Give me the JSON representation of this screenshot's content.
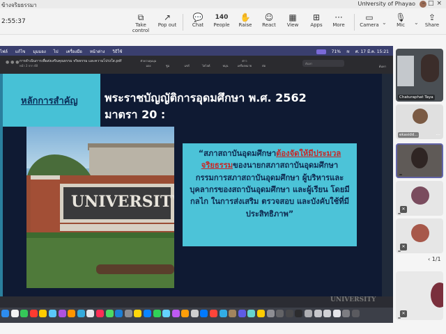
{
  "titlebar": {
    "left_text": "ข้างจริยธรรมา",
    "dots": "···",
    "org_name": "University of Phayao",
    "window_controls": "–□×"
  },
  "toolbar": {
    "timer": "2:55:37",
    "buttons": [
      {
        "icon": "take-control-icon",
        "glyph": "⧉",
        "label": "Take control"
      },
      {
        "icon": "pop-out-icon",
        "glyph": "↗",
        "label": "Pop out"
      },
      {
        "icon": "chat-icon",
        "glyph": "💬",
        "label": "Chat"
      },
      {
        "icon": "people-icon",
        "glyph": "140",
        "label": "People"
      },
      {
        "icon": "raise-hand-icon",
        "glyph": "✋",
        "label": "Raise"
      },
      {
        "icon": "react-icon",
        "glyph": "☺",
        "label": "React"
      },
      {
        "icon": "view-icon",
        "glyph": "▦",
        "label": "View"
      },
      {
        "icon": "apps-icon",
        "glyph": "⊞",
        "label": "Apps"
      },
      {
        "icon": "more-icon",
        "glyph": "···",
        "label": "More"
      },
      {
        "icon": "camera-icon",
        "glyph": "▭",
        "label": "Camera"
      },
      {
        "icon": "mic-off-icon",
        "glyph": "🎙",
        "label": "Mic"
      },
      {
        "icon": "share-icon",
        "glyph": "⇪",
        "label": "Share"
      }
    ]
  },
  "macbar": {
    "menu": [
      "ไฟล์",
      "แก้ไข",
      "มุมมอง",
      "ไป",
      "เครื่องมือ",
      "หน้าต่าง",
      "วิธีใช้"
    ],
    "status": [
      "71%",
      "ศ. 17 มี.ค. 15:21"
    ]
  },
  "viewer": {
    "filename": "การดำเนินการเพื่อส่งเสริมคุณธรรม จริยธรรม และความโปร่งใส.pdf",
    "pages": "หน้า 3 จาก 48",
    "tools": [
      "ตัวควบคุมมุมมอง",
      "ซูม",
      "แชร์",
      "ไฮไลต์",
      "หมุน",
      "ต่าวเครื่องหมาย",
      "ต่อ"
    ],
    "search_placeholder": "ค้นหา",
    "share_label": "ค้นหา"
  },
  "slide": {
    "keyword": "หลักการสำคัญ",
    "headline_line1": "พระราชบัญญัติการอุดมศึกษา พ.ศ. 2562",
    "headline_line2": "มาตรา 20 :",
    "sign_text": "UNIVERSITY",
    "quote_open": "“สภาสถาบันอุดมศึกษา",
    "quote_emph1": "ต้องจัดให้มี",
    "quote_emph2": "ประมวลจริยธรรม",
    "quote_rest": "ของนายกสภาสถาบันอุดมศึกษา กรรมการสภาสถาบันอุดมศึกษา ผู้บริหารและบุคลากรของสถาบันอุดมศึกษา และผู้เรียน โดยมีกลไก ในการส่งเสริม ตรวจสอบ และบังคับใช้ที่มีประสิทธิภาพ”",
    "ghost_text": "UNIVERSITY"
  },
  "panel": {
    "participants": [
      {
        "name": "Chaturaphat Taya"
      },
      {
        "name": "ekasidd..."
      },
      {
        "name": ""
      },
      {
        "name": ""
      },
      {
        "name": ""
      },
      {
        "name": ""
      }
    ],
    "pager": "‹ 1/1"
  },
  "colors": {
    "slide_bg": "#0f1a33",
    "accent_cyan": "#4cc3d8",
    "emphasis_red": "#c62828",
    "teams_purple": "#6264a7"
  }
}
